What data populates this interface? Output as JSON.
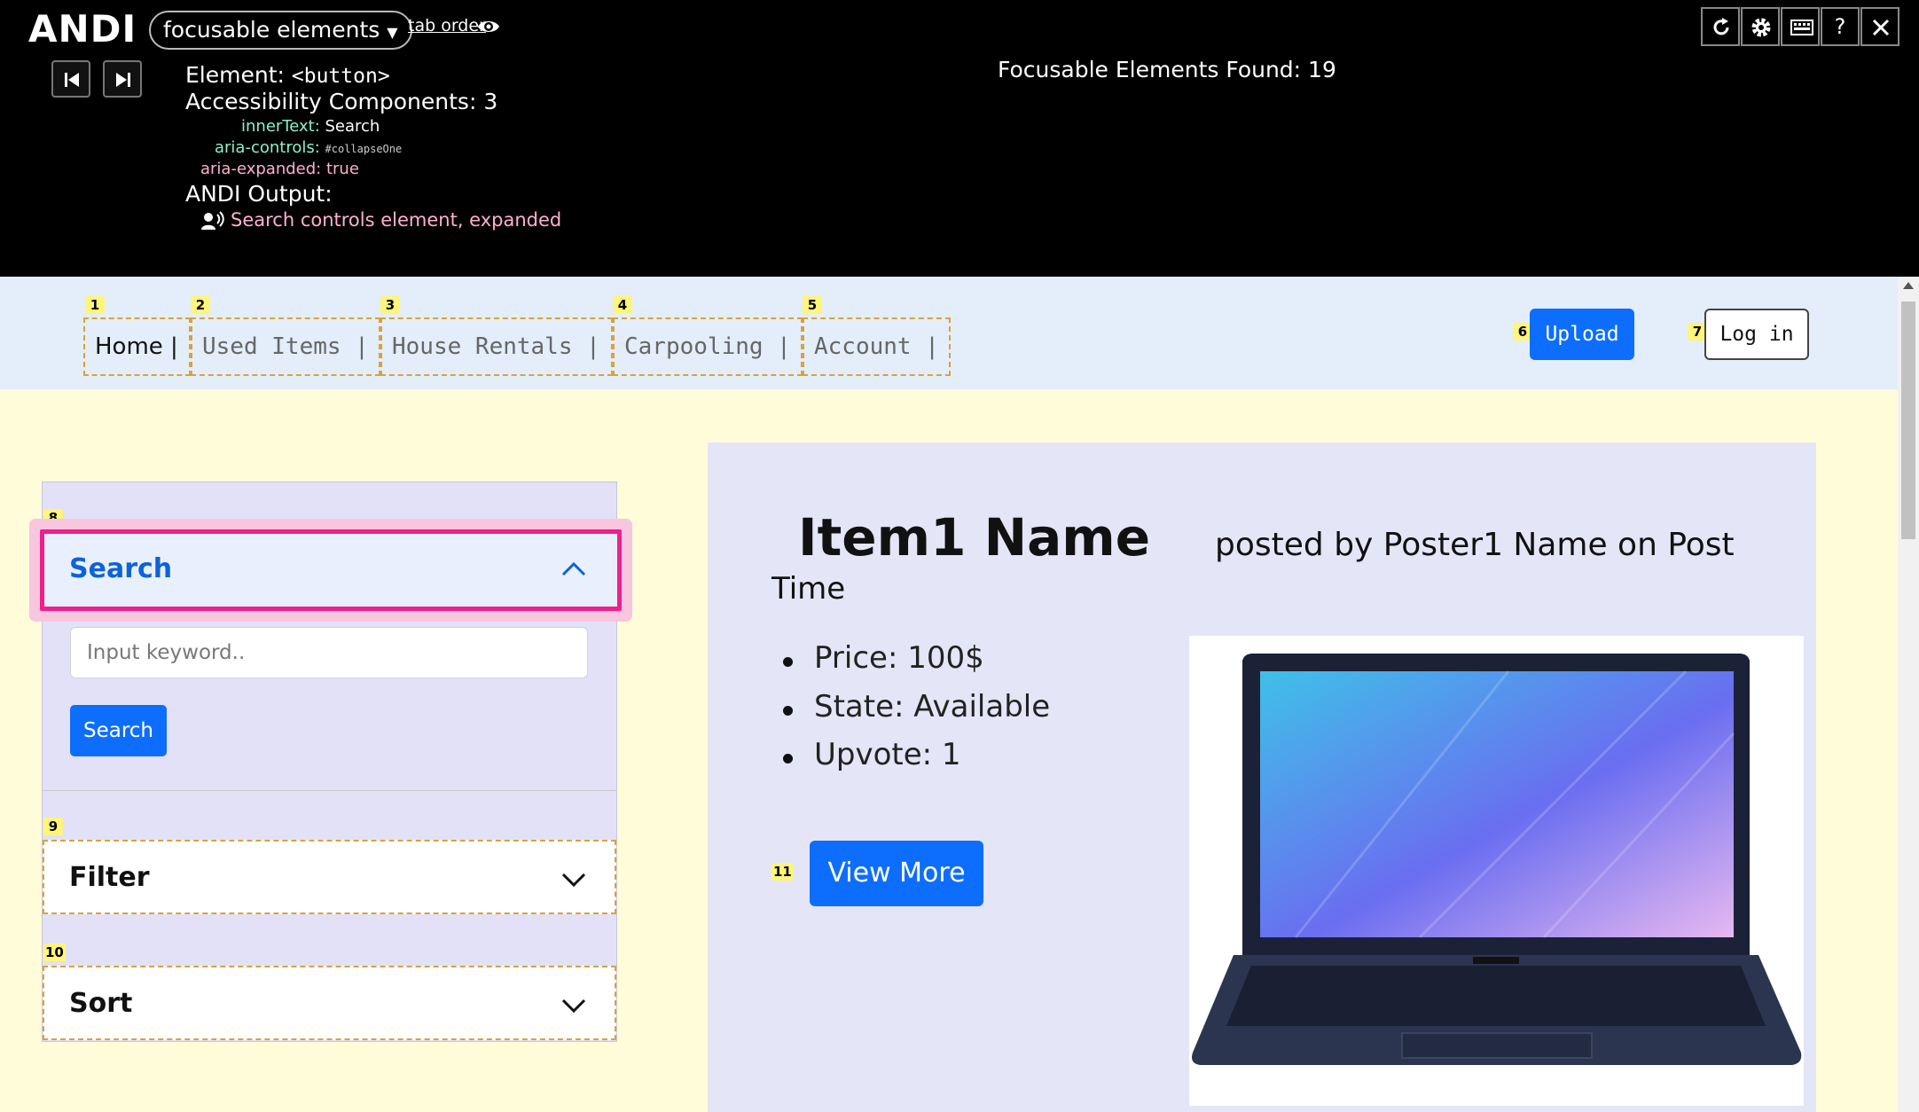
{
  "andi": {
    "logo": "ANDI",
    "mode": "focusable elements",
    "tab_order": "tab order",
    "element_label": "Element:",
    "element_tag": "<button>",
    "components_label": "Accessibility Components: 3",
    "components": [
      {
        "key": "innerText:",
        "value": "Search"
      },
      {
        "key": "aria-controls:",
        "value": "#collapseOne"
      },
      {
        "key": "aria-expanded:",
        "value": "true"
      }
    ],
    "output_label": "ANDI Output:",
    "output_text": "Search controls element, expanded",
    "found": "Focusable Elements Found: 19",
    "help": "?"
  },
  "nav": {
    "items": [
      {
        "badge": "1",
        "label": "Home |"
      },
      {
        "badge": "2",
        "label": "Used Items |"
      },
      {
        "badge": "3",
        "label": "House Rentals |"
      },
      {
        "badge": "4",
        "label": "Carpooling |"
      },
      {
        "badge": "5",
        "label": "Account |"
      }
    ],
    "upload": {
      "badge": "6",
      "label": "Upload"
    },
    "login": {
      "badge": "7",
      "label": "Log in"
    }
  },
  "sidebar": {
    "search": {
      "badge": "8",
      "title": "Search",
      "placeholder": "Input keyword..",
      "button": "Search"
    },
    "filter": {
      "badge": "9",
      "title": "Filter"
    },
    "sort": {
      "badge": "10",
      "title": "Sort"
    }
  },
  "item": {
    "name": "Item1 Name",
    "posted_by": "posted by Poster1 Name on Post",
    "time": "Time",
    "details": [
      "Price: 100$",
      "State: Available",
      "Upvote: 1"
    ],
    "view_more": {
      "badge": "11",
      "label": "View More"
    }
  },
  "colors": {
    "primary": "#0d6efd",
    "focus": "#ef1f8e",
    "badge": "#fff57a"
  }
}
